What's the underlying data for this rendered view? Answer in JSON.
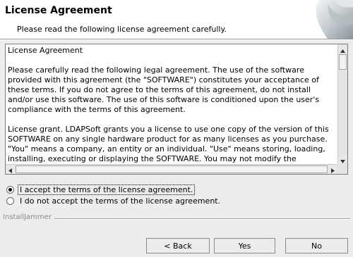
{
  "header": {
    "title": "License Agreement",
    "subtitle": "Please read the following license agreement carefully."
  },
  "license_text": "License Agreement\n\nPlease carefully read the following legal agreement. The use of the software provided with this agreement (the \"SOFTWARE\") constitutes your acceptance of these terms. If you do not agree to the terms of this agreement, do not install and/or use this software. The use of this software is conditioned upon the user's compliance with the terms of this agreement.\n\nLicense grant. LDAPSoft grants you a license to use one copy of the version of this SOFTWARE on any single hardware product for as many licenses as you purchase. \"You\" means a company, an entity or an individual. \"Use\" means storing, loading, installing, executing or displaying the SOFTWARE. You may not modify the SOFTWARE or disable any licensing or control features of the",
  "options": {
    "accept": "I accept the terms of the license agreement.",
    "decline": "I do not accept the terms of the license agreement.",
    "selected": "accept"
  },
  "brand": "InstallJammer",
  "buttons": {
    "back": "< Back",
    "yes": "Yes",
    "no": "No"
  },
  "icons": {
    "scroll_up": "triangle-up-icon",
    "scroll_down": "triangle-down-icon",
    "scroll_left": "triangle-left-icon",
    "scroll_right": "triangle-right-icon"
  }
}
